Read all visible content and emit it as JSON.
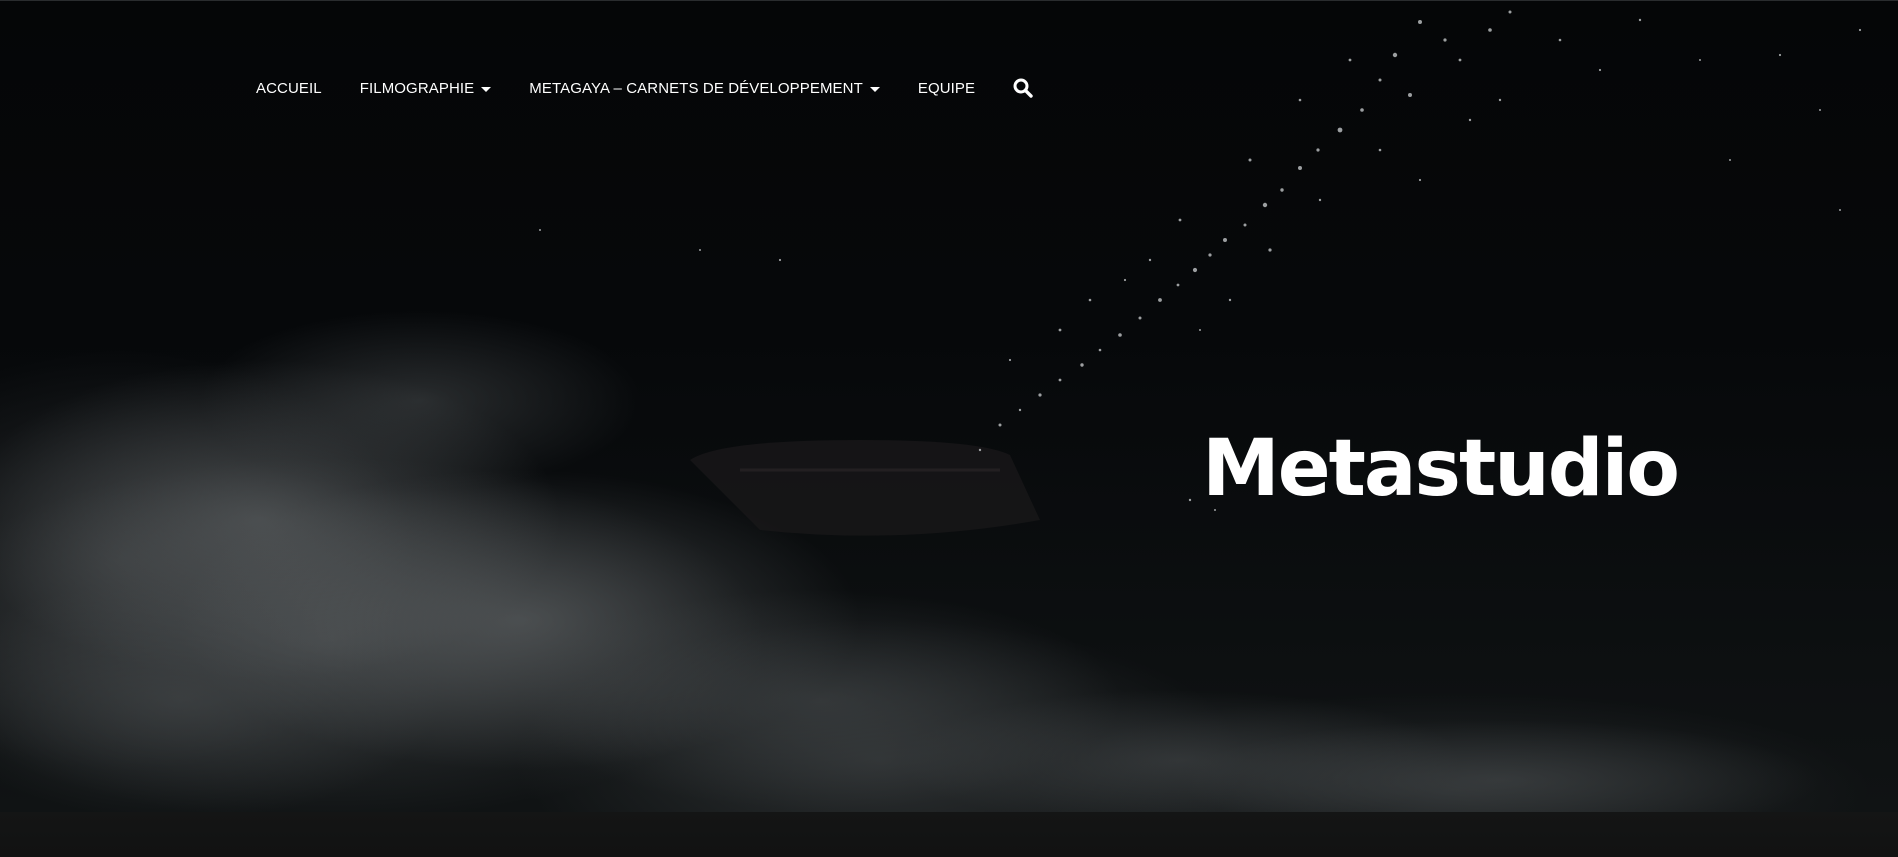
{
  "nav": {
    "items": [
      {
        "label": "ACCUEIL",
        "dropdown": false
      },
      {
        "label": "FILMOGRAPHIE",
        "dropdown": true
      },
      {
        "label": "METAGAYA – CARNETS DE DÉVELOPPEMENT",
        "dropdown": true
      },
      {
        "label": "EQUIPE",
        "dropdown": false
      }
    ],
    "search_icon": "search-icon"
  },
  "hero": {
    "title": "Metastudio"
  },
  "colors": {
    "background": "#0a0b0c",
    "text": "#ffffff",
    "fog": "#5a5e60"
  }
}
